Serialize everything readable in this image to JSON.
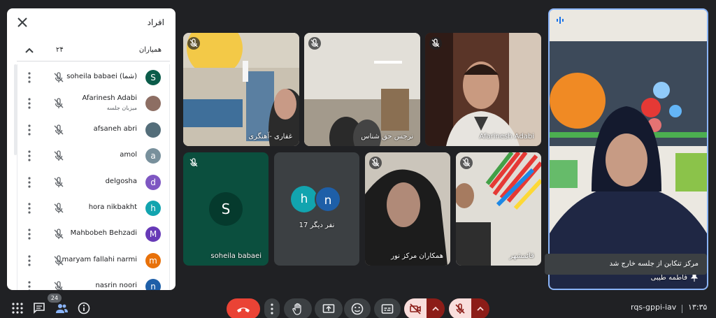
{
  "panel": {
    "title": "افراد",
    "section_label": "همیاران",
    "section_count": "۲۴",
    "participants": [
      {
        "name": "soheila babaei (شما)",
        "sub": "",
        "initial": "S",
        "color": "#0b5c4a"
      },
      {
        "name": "Afarinesh Adabi",
        "sub": "میزبان جلسه",
        "initial": "",
        "color": "#8d6e63"
      },
      {
        "name": "afsaneh abri",
        "sub": "",
        "initial": "",
        "color": "#546e7a"
      },
      {
        "name": "amol",
        "sub": "",
        "initial": "a",
        "color": "#78909c"
      },
      {
        "name": "delgosha",
        "sub": "",
        "initial": "d",
        "color": "#7e57c2"
      },
      {
        "name": "hora nikbakht",
        "sub": "",
        "initial": "h",
        "color": "#12a4af"
      },
      {
        "name": "Mahbobeh Behzadi",
        "sub": "",
        "initial": "M",
        "color": "#673ab7"
      },
      {
        "name": "maryam fallahi narmi",
        "sub": "",
        "initial": "m",
        "color": "#e8710a"
      },
      {
        "name": "nasrin noori",
        "sub": "",
        "initial": "n",
        "color": "#1e5fa8"
      }
    ]
  },
  "tiles": {
    "t1": "غفاری -آهنگری",
    "t2": "نرجس حق شناس",
    "t3": "Afarinesh Adabi",
    "t4": "soheila babaei",
    "t4_initial": "S",
    "t5": "17 نفر دیگر",
    "t5_av1": "h",
    "t5_av2": "n",
    "t6": "همکاران مرکز نور",
    "t7": "قائمشهر",
    "speaker": "فاطمه طیبی"
  },
  "toast": "مرکز تنکابن از جلسه خارج شد",
  "bottom": {
    "people_badge": "24",
    "meeting_code": "rqs-gppi-iav",
    "clock": "۱۳:۳۵"
  },
  "colors": {
    "end_call": "#ea4335",
    "muted": "#f9dedc",
    "muted_dark": "#8c1d18",
    "host_tile": "#0b4f3e"
  }
}
